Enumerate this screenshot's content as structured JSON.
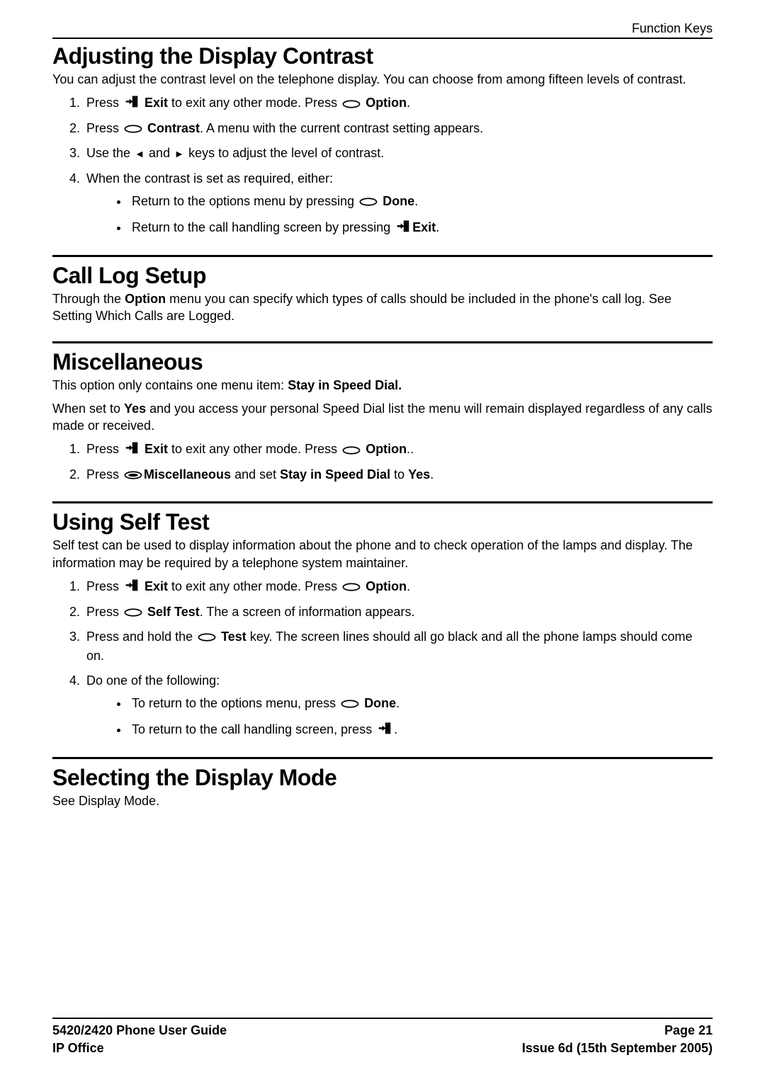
{
  "header": {
    "right": "Function Keys"
  },
  "sections": {
    "adjusting": {
      "title": "Adjusting the Display Contrast",
      "intro": "You can adjust the contrast level on the telephone display. You can choose from among fifteen levels of contrast.",
      "steps": {
        "s1a": "Press ",
        "s1_exit": "Exit",
        "s1b": " to exit any other mode. Press ",
        "s1_option": "Option",
        "s1c": ".",
        "s2a": "Press ",
        "s2_contrast": "Contrast",
        "s2b": ". A menu with the current contrast setting appears.",
        "s3a": "Use the ",
        "s3b": " and ",
        "s3c": " keys to adjust the level of contrast.",
        "s4": "When the contrast is set as required, either:",
        "b1a": "Return to the options menu by pressing ",
        "b1_done": "Done",
        "b1b": ".",
        "b2a": "Return to the call handling screen by pressing ",
        "b2_exit": "Exit",
        "b2b": "."
      }
    },
    "calllog": {
      "title": "Call Log Setup",
      "p1a": "Through the ",
      "p1_option": "Option",
      "p1b": " menu you can specify which types of calls should be included in the phone's call log. See Setting Which Calls are Logged."
    },
    "misc": {
      "title": "Miscellaneous",
      "p1a": "This option only contains one menu item: ",
      "p1_stay": "Stay in Speed Dial.",
      "p2a": "When set to ",
      "p2_yes": "Yes",
      "p2b": " and you access your personal Speed Dial list the menu will remain displayed regardless of any calls made or received.",
      "steps": {
        "s1a": "Press ",
        "s1_exit": "Exit",
        "s1b": " to exit any other mode. Press ",
        "s1_option": "Option",
        "s1c": "..",
        "s2a": "Press ",
        "s2_misc": "Miscellaneous",
        "s2b": " and set ",
        "s2_stay": "Stay in Speed Dial",
        "s2c": " to ",
        "s2_yes": "Yes",
        "s2d": "."
      }
    },
    "selftest": {
      "title": "Using Self Test",
      "intro": "Self test can be used to display information about the phone and to check operation of the lamps and display. The information may be required by a telephone system maintainer.",
      "steps": {
        "s1a": "Press ",
        "s1_exit": "Exit",
        "s1b": " to exit any other mode. Press ",
        "s1_option": "Option",
        "s1c": ".",
        "s2a": "Press ",
        "s2_st": "Self Test",
        "s2b": ". The a screen of information appears.",
        "s3a": "Press and hold the ",
        "s3_test": "Test",
        "s3b": " key. The screen lines should all go black and all the phone lamps should come on.",
        "s4": "Do one of the following:",
        "b1a": "To return to the options menu, press ",
        "b1_done": "Done",
        "b1b": ".",
        "b2a": "To return to the call handling screen, press ",
        "b2b": "."
      }
    },
    "displaymode": {
      "title": "Selecting the Display Mode",
      "p": "See Display Mode."
    }
  },
  "footer": {
    "left1": "5420/2420 Phone User Guide",
    "left2": "IP Office",
    "right1": "Page 21",
    "right2": "Issue 6d (15th September 2005)"
  }
}
